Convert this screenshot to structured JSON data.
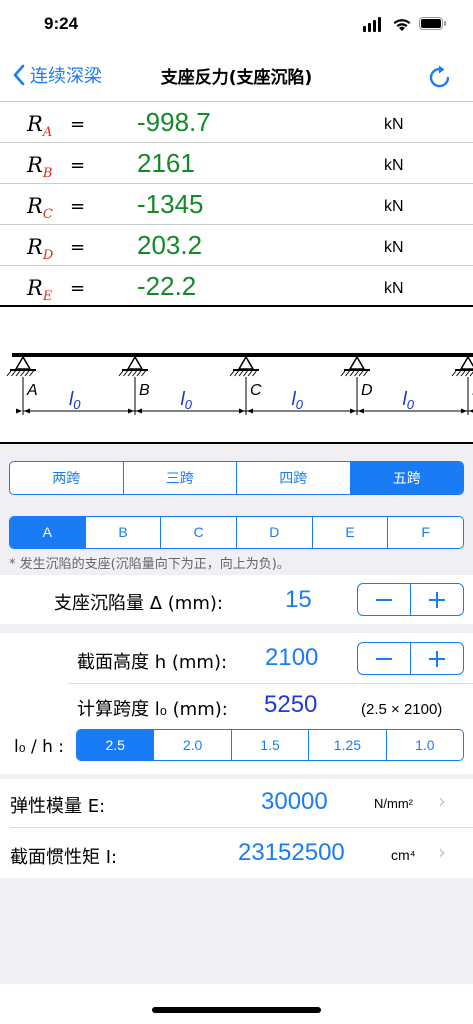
{
  "status": {
    "time": "9:24"
  },
  "nav": {
    "back_label": "连续深梁",
    "title": "支座反力(支座沉陷)"
  },
  "reactions": [
    {
      "name": "R",
      "sub": "A",
      "eq": "=",
      "value": "-998.7",
      "unit": "kN"
    },
    {
      "name": "R",
      "sub": "B",
      "eq": "=",
      "value": "2161",
      "unit": "kN"
    },
    {
      "name": "R",
      "sub": "C",
      "eq": "=",
      "value": "-1345",
      "unit": "kN"
    },
    {
      "name": "R",
      "sub": "D",
      "eq": "=",
      "value": "203.2",
      "unit": "kN"
    },
    {
      "name": "R",
      "sub": "E",
      "eq": "=",
      "value": "-22.2",
      "unit": "kN"
    }
  ],
  "diagram": {
    "supports": [
      "A",
      "B",
      "C",
      "D",
      "E"
    ],
    "span_label": "l",
    "span_sub": "0"
  },
  "spans_seg": {
    "options": [
      "两跨",
      "三跨",
      "四跨",
      "五跨"
    ],
    "selected": 3
  },
  "support_seg": {
    "options": [
      "A",
      "B",
      "C",
      "D",
      "E",
      "F"
    ],
    "selected": 0
  },
  "note": "* 发生沉陷的支座(沉陷量向下为正，向上为负)。",
  "settlement": {
    "label": "支座沉陷量  Δ (mm):",
    "value": "15"
  },
  "height": {
    "label": "截面高度  h (mm):",
    "value": "2100"
  },
  "span": {
    "label": "计算跨度  l₀ (mm):",
    "value": "5250",
    "hint": "(2.5 × 2100)"
  },
  "ratio": {
    "label": "l₀ / h :",
    "options": [
      "2.5",
      "2.0",
      "1.5",
      "1.25",
      "1.0"
    ],
    "selected": 0
  },
  "modulus": {
    "label": "弹性模量  E:",
    "value": "30000",
    "unit": "N/mm²"
  },
  "inertia": {
    "label": "截面惯性矩  I:",
    "value": "23152500",
    "unit": "cm⁴"
  },
  "colors": {
    "accent": "#1a7cf5",
    "value_green": "#118a28",
    "sub_red": "#d8301c"
  }
}
